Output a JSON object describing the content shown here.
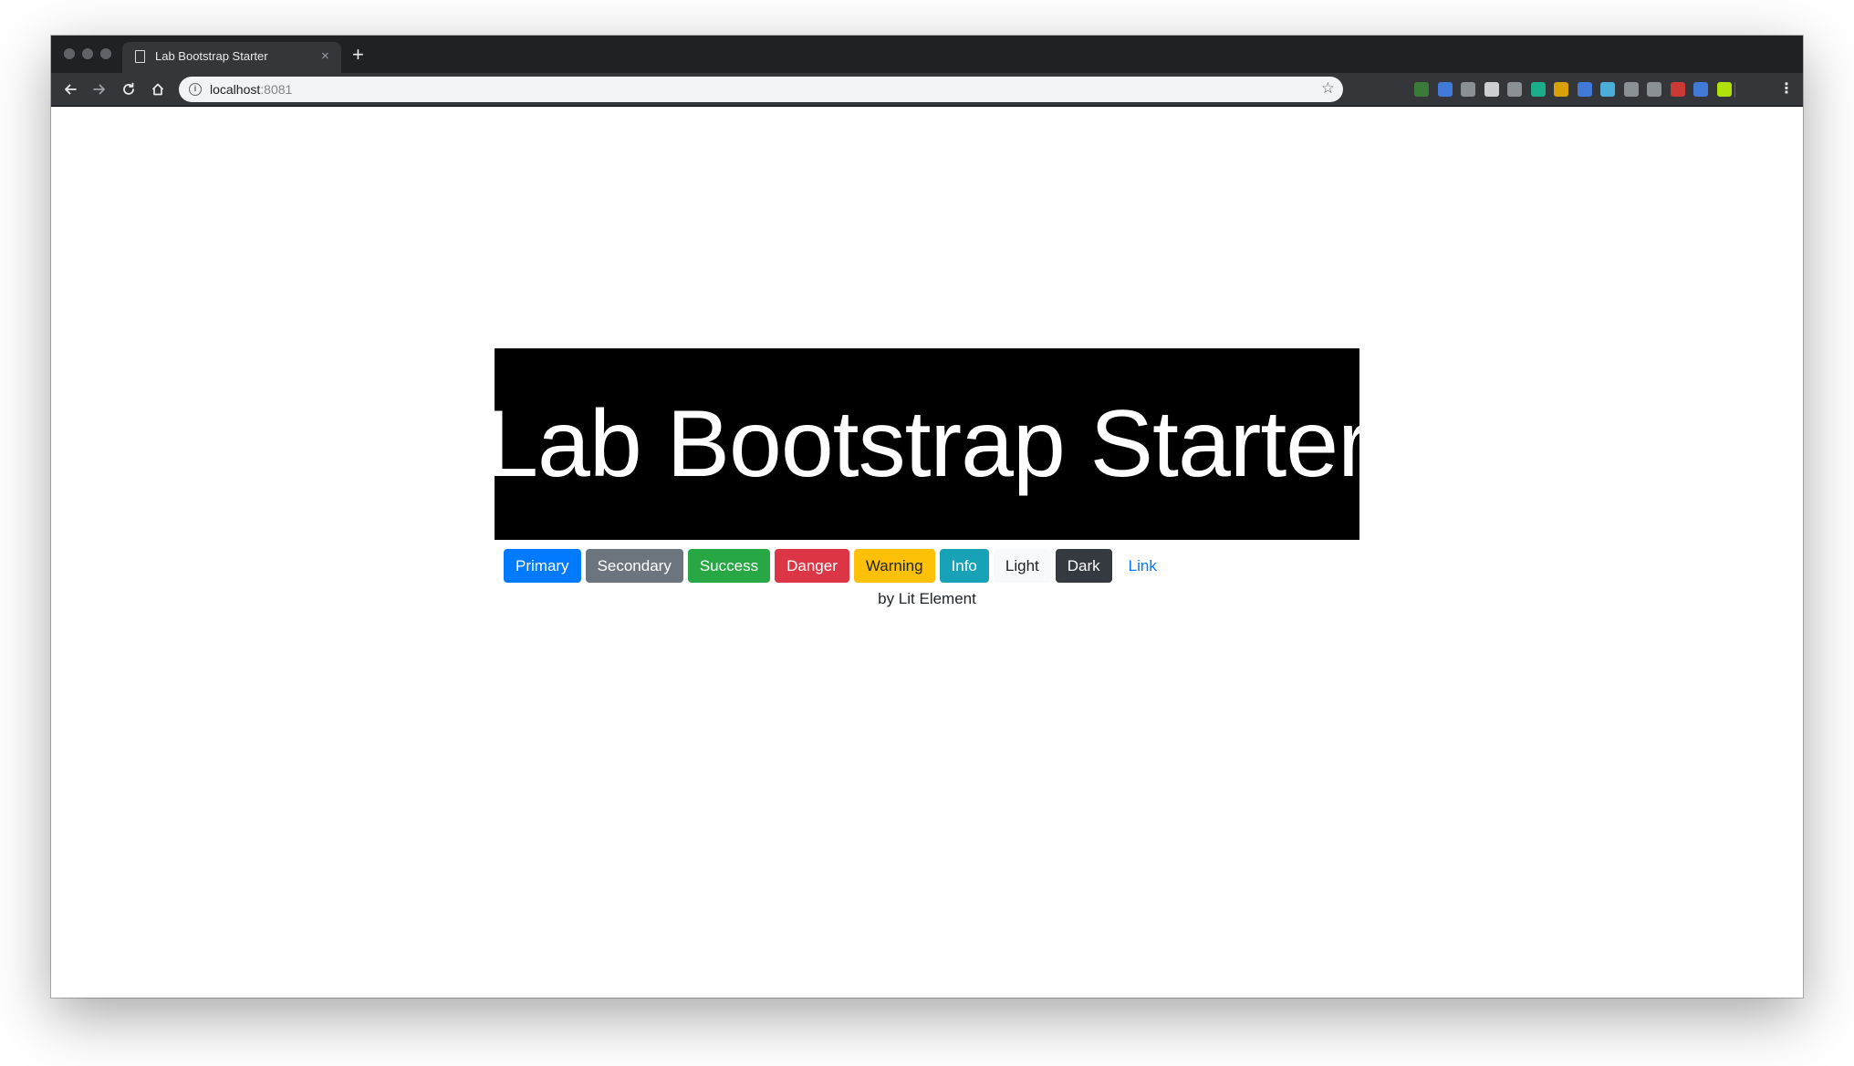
{
  "browser": {
    "tab": {
      "title": "Lab Bootstrap Starter",
      "close_icon": "×"
    },
    "new_tab_icon": "+",
    "omnibox": {
      "host": "localhost",
      "port": ":8081"
    },
    "menu_icon": "⋮"
  },
  "page": {
    "heading": "Lab Bootstrap Starter",
    "buttons": [
      {
        "label": "Primary",
        "bg": "#007bff",
        "fg": "#ffffff"
      },
      {
        "label": "Secondary",
        "bg": "#6c757d",
        "fg": "#ffffff"
      },
      {
        "label": "Success",
        "bg": "#28a745",
        "fg": "#ffffff"
      },
      {
        "label": "Danger",
        "bg": "#dc3545",
        "fg": "#ffffff"
      },
      {
        "label": "Warning",
        "bg": "#ffc107",
        "fg": "#212529"
      },
      {
        "label": "Info",
        "bg": "#17a2b8",
        "fg": "#ffffff"
      },
      {
        "label": "Light",
        "bg": "#f8f9fa",
        "fg": "#212529"
      },
      {
        "label": "Dark",
        "bg": "#343a40",
        "fg": "#ffffff"
      },
      {
        "label": "Link",
        "bg": "transparent",
        "fg": "#007bff"
      }
    ],
    "byline": "by Lit Element"
  },
  "extensions": [
    {
      "name": "nodejs-extension-icon",
      "color": "#3c873a"
    },
    {
      "name": "extension-icon-2",
      "color": "#4285f4"
    },
    {
      "name": "camera-extension-icon",
      "color": "#9aa0a6"
    },
    {
      "name": "react-devtools-icon",
      "color": "#e8eaed"
    },
    {
      "name": "code-extension-icon",
      "color": "#9aa0a6"
    },
    {
      "name": "grammarly-icon",
      "color": "#15c39a"
    },
    {
      "name": "notes-extension-icon",
      "color": "#f4b400"
    },
    {
      "name": "extension-icon-8",
      "color": "#4285f4"
    },
    {
      "name": "extension-icon-9",
      "color": "#4fc3f7"
    },
    {
      "name": "vue-devtools-icon",
      "color": "#9aa0a6"
    },
    {
      "name": "extension-icon-11",
      "color": "#9aa0a6"
    },
    {
      "name": "color-picker-icon",
      "color": "#e53935"
    },
    {
      "name": "extension-icon-13",
      "color": "#4285f4"
    },
    {
      "name": "extension-icon-14",
      "color": "#c6ff00"
    }
  ]
}
